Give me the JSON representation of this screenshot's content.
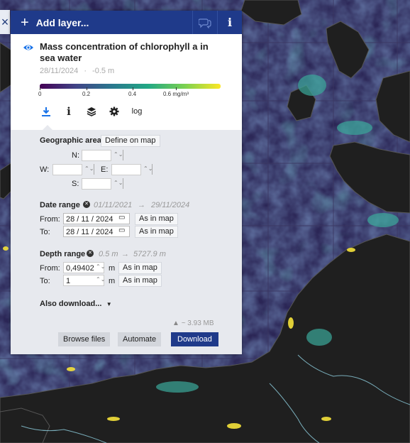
{
  "topbar": {
    "add_layer_label": "Add layer...",
    "info_label": "i"
  },
  "layer": {
    "title": "Mass concentration of chlorophyll a in sea water",
    "date": "28/11/2024",
    "separator": "·",
    "depth": "-0.5 m"
  },
  "colorbar": {
    "ticks": [
      "0",
      "0.2",
      "0.4",
      "0.6 mg/m³"
    ]
  },
  "tabs": {
    "info": "i",
    "log": "log"
  },
  "geo": {
    "heading": "Geographic area",
    "define_button": "Define on map",
    "n_label": "N:",
    "w_label": "W:",
    "e_label": "E:",
    "s_label": "S:"
  },
  "date_range": {
    "heading": "Date range",
    "start": "01/11/2021",
    "arrow": "→",
    "end": "29/11/2024",
    "from_label": "From:",
    "from_value": "28 / 11 / 2024",
    "to_label": "To:",
    "to_value": "28 / 11 / 2024",
    "as_in_map": "As in map"
  },
  "depth_range": {
    "heading": "Depth range",
    "start": "0.5 m",
    "arrow": "→",
    "end": "5727.9 m",
    "from_label": "From:",
    "from_value": "0,49402",
    "to_label": "To:",
    "to_value": "1",
    "unit": "m",
    "as_in_map": "As in map"
  },
  "also_download": "Also download...",
  "size": "~ 3.93 MB",
  "buttons": {
    "browse": "Browse files",
    "automate": "Automate",
    "download": "Download"
  },
  "colors": {
    "accent": "#1f3a8a",
    "active_tab": "#1a73e8",
    "panel_bg": "#e7e9ee"
  }
}
